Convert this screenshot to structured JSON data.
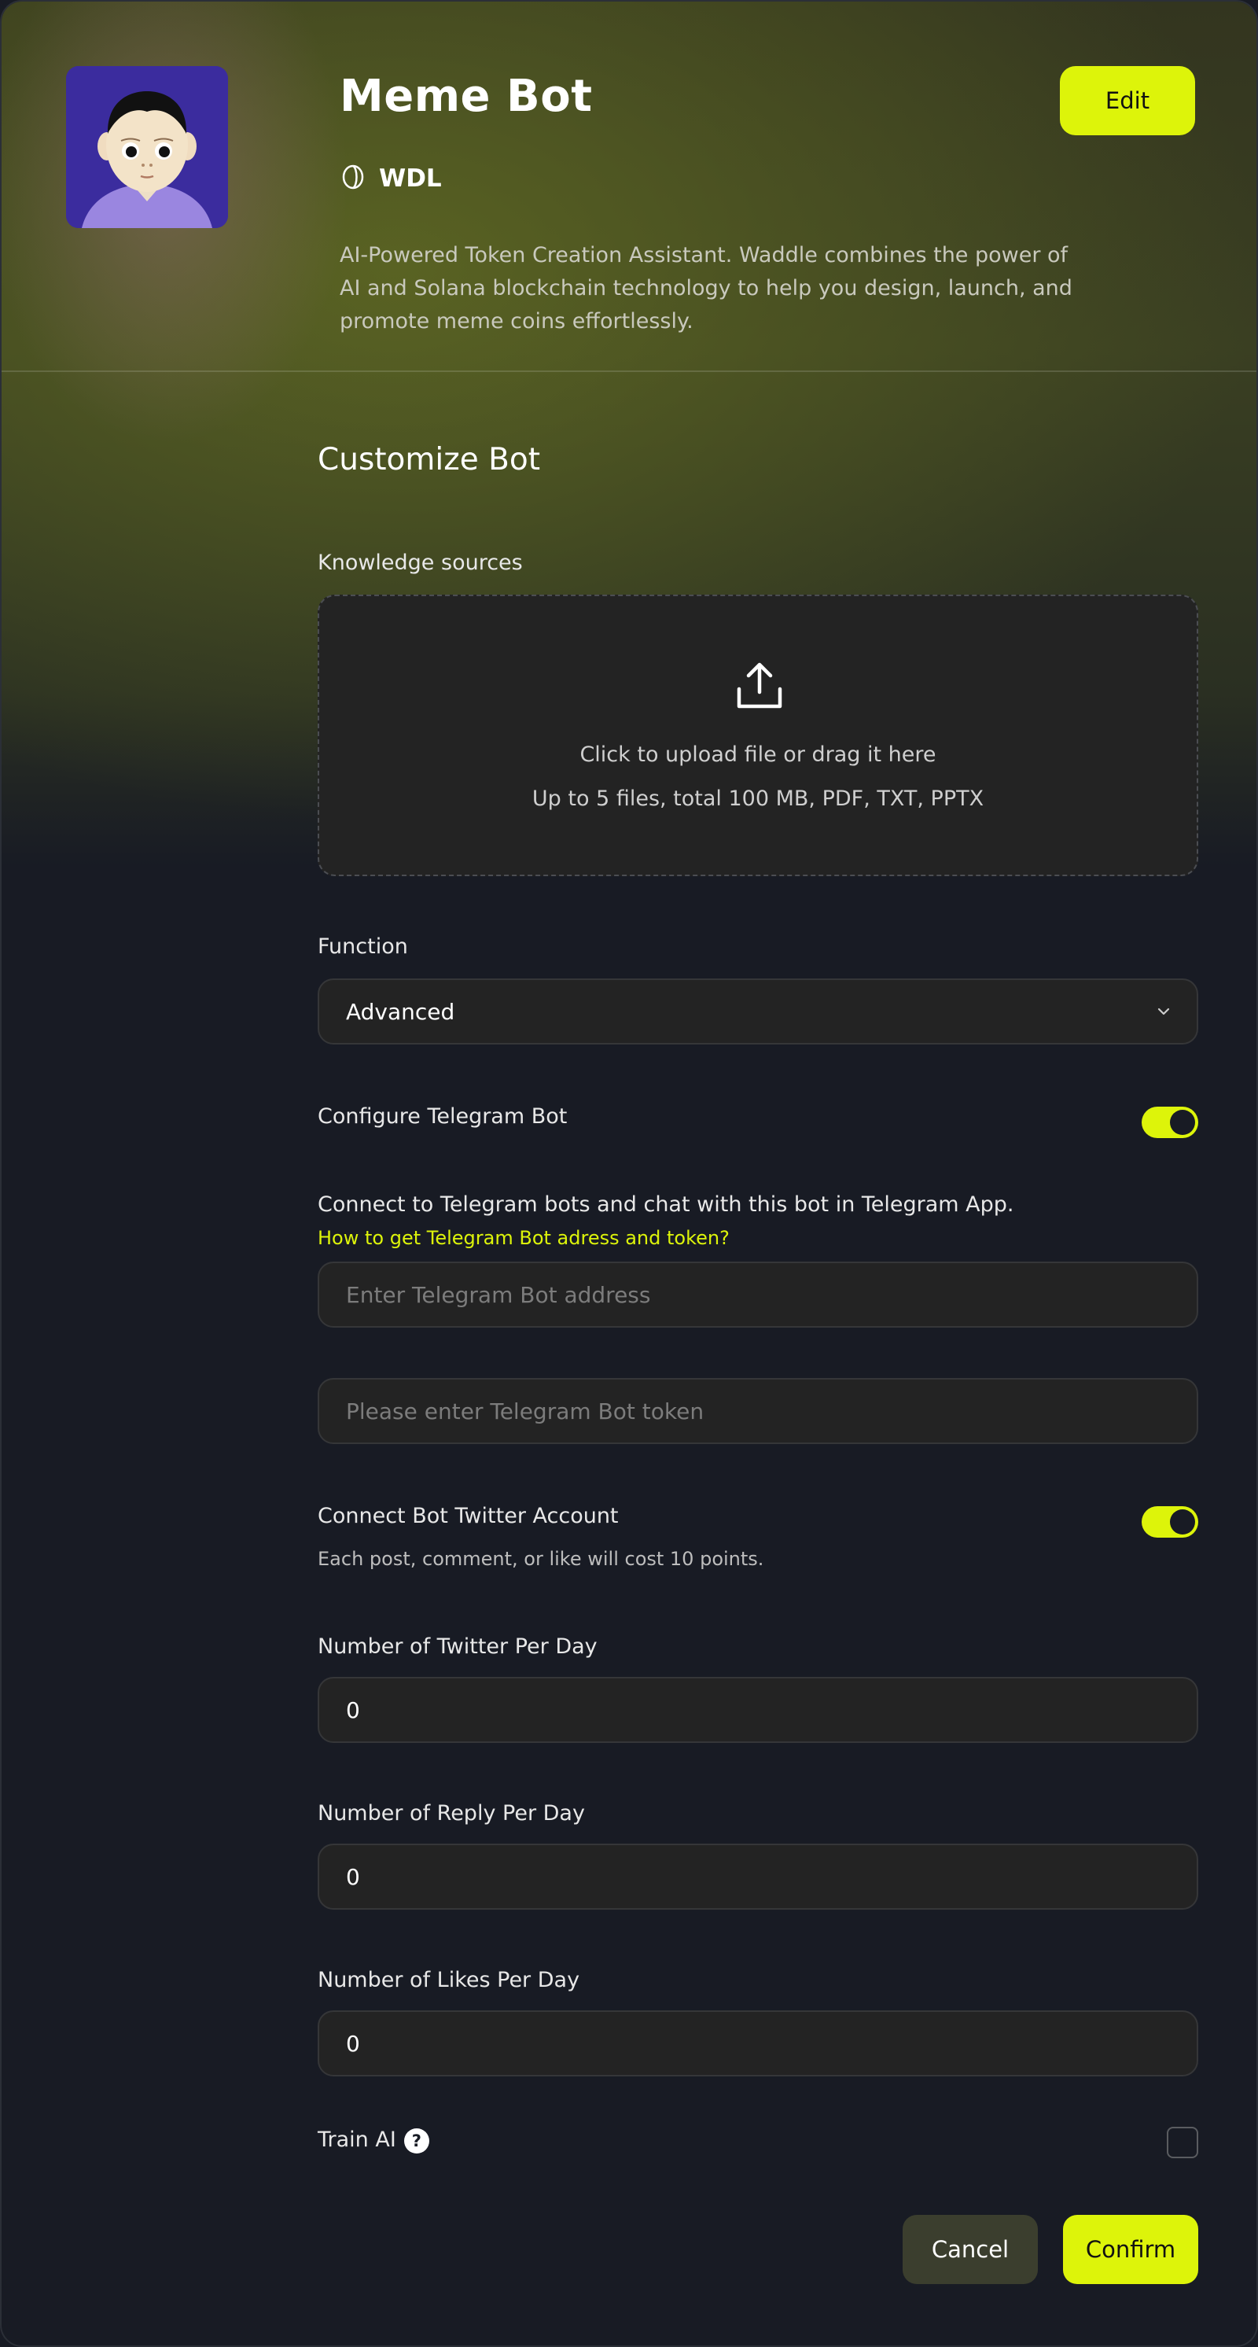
{
  "bot": {
    "name": "Meme Bot",
    "ticker": "WDL",
    "description": "AI-Powered Token Creation Assistant. Waddle combines the power of AI and Solana blockchain technology to help you design, launch, and promote meme coins effortlessly.",
    "edit_label": "Edit"
  },
  "customize": {
    "title": "Customize Bot",
    "knowledge": {
      "label": "Knowledge sources",
      "upload_primary": "Click to upload file or drag it here",
      "upload_secondary": "Up to 5 files, total 100 MB, PDF, TXT, PPTX"
    },
    "function": {
      "label": "Function",
      "selected": "Advanced"
    },
    "telegram": {
      "label": "Configure Telegram Bot",
      "enabled": true,
      "description": "Connect to Telegram bots and chat with this bot in Telegram App.",
      "help_link": "How to get Telegram Bot adress and token?",
      "address_placeholder": "Enter Telegram Bot address",
      "token_placeholder": "Please enter Telegram Bot token"
    },
    "twitter": {
      "label": "Connect Bot Twitter Account",
      "enabled": true,
      "note": "Each post, comment, or like will cost 10 points.",
      "tweets_label": "Number of Twitter Per Day",
      "tweets_value": "0",
      "replies_label": "Number of Reply Per Day",
      "replies_value": "0",
      "likes_label": "Number of Likes Per Day",
      "likes_value": "0"
    },
    "train_ai": {
      "label": "Train AI",
      "help_glyph": "?",
      "checked": false
    }
  },
  "actions": {
    "cancel": "Cancel",
    "confirm": "Confirm"
  },
  "colors": {
    "accent": "#ddf40a",
    "background": "#181b24",
    "field": "#232323"
  }
}
